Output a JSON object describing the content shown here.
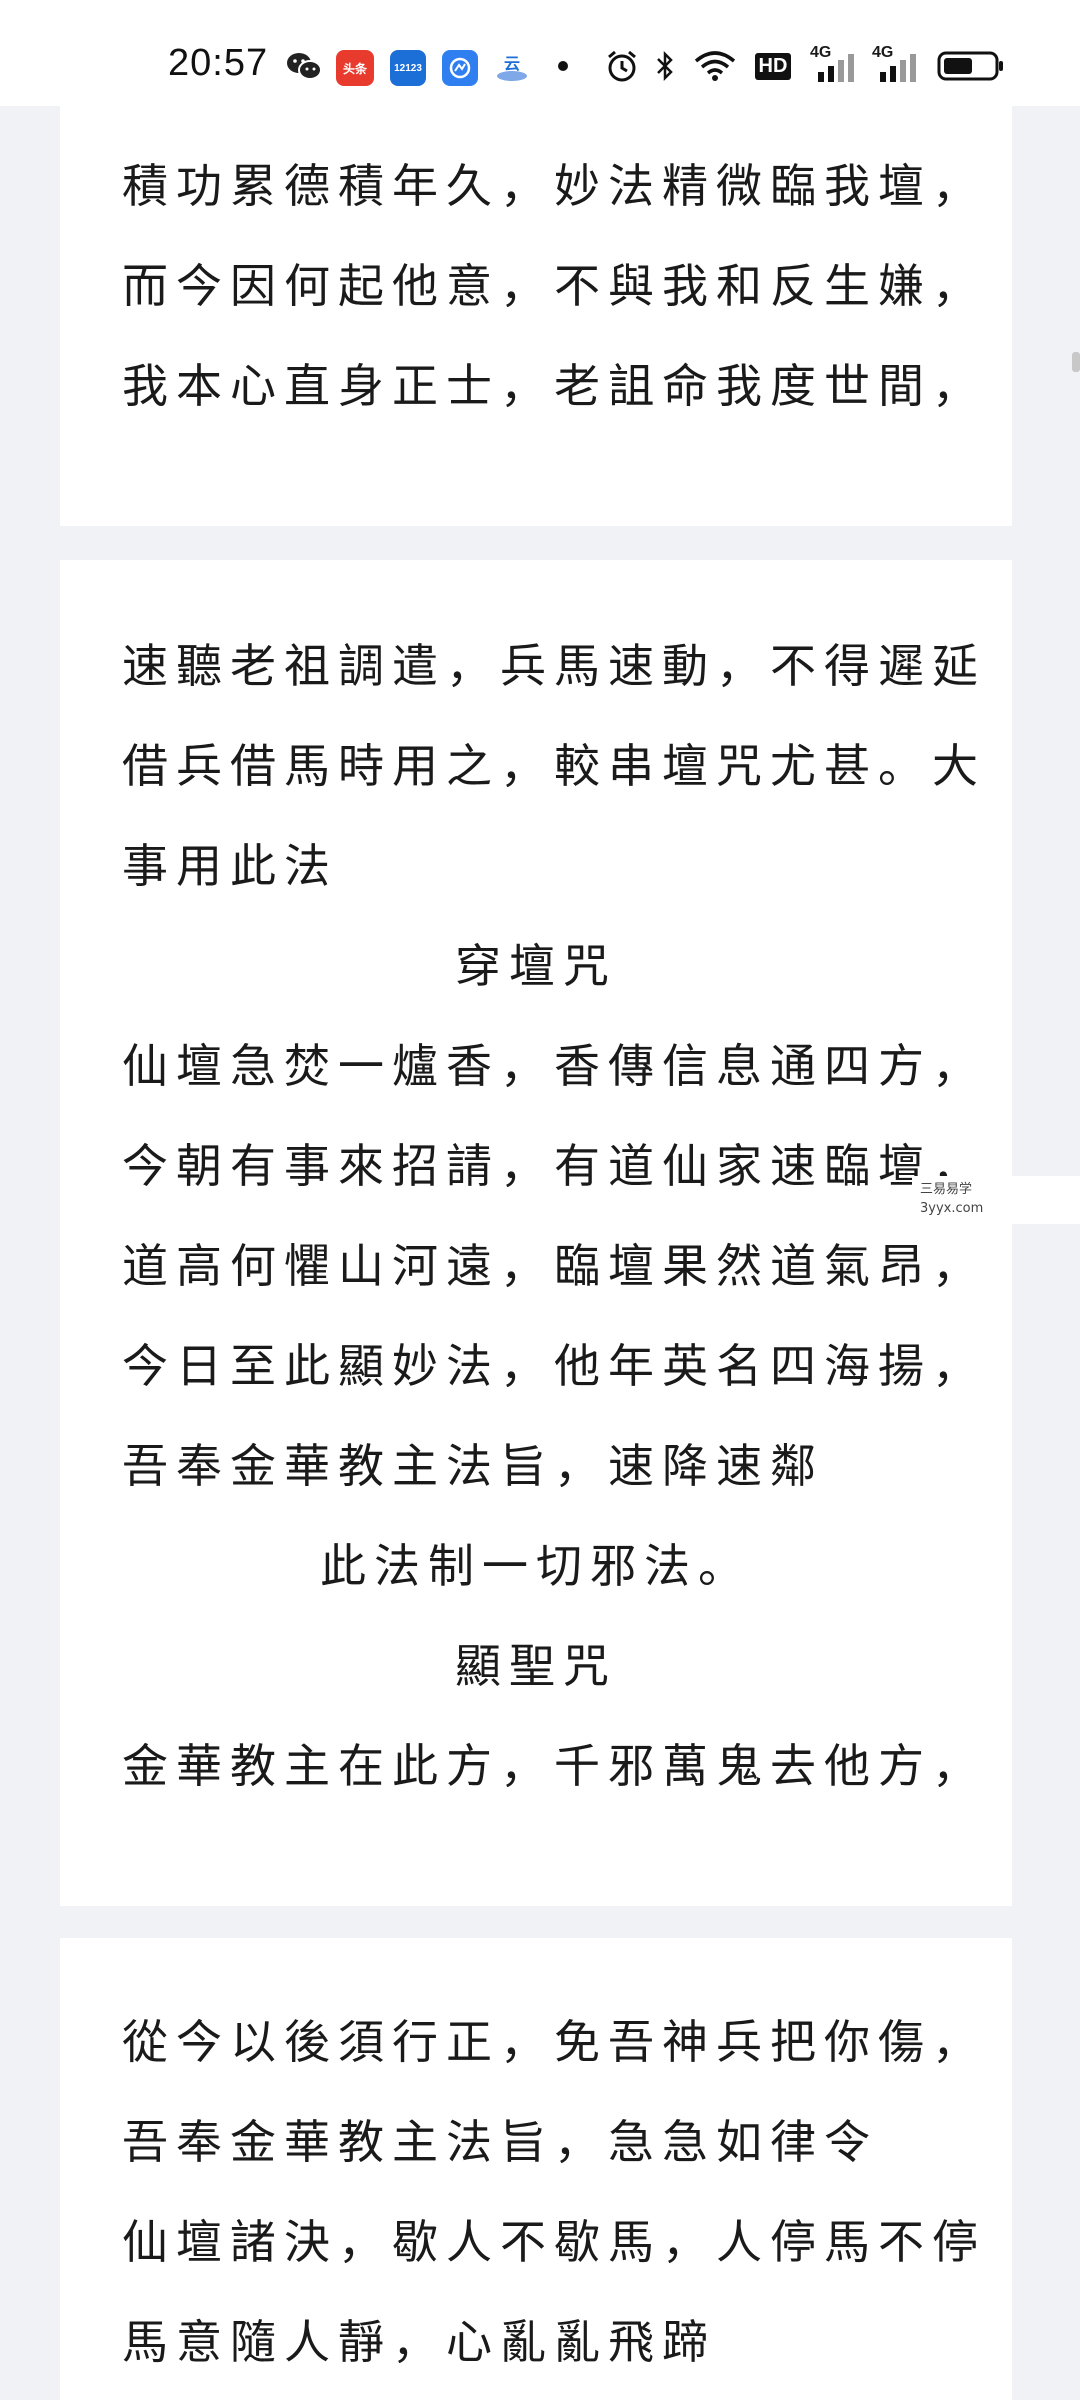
{
  "status_bar": {
    "time": "20:57",
    "icons": [
      "wechat-icon",
      "toutiao-icon",
      "traffic-12123-icon",
      "app-icon",
      "cloud-app-icon",
      "dot-icon",
      "alarm-icon",
      "bluetooth-icon",
      "wifi-icon",
      "hd-icon",
      "signal-4g-icon",
      "signal-4g-icon",
      "battery-icon"
    ],
    "badge_toutiao": "头条",
    "badge_12123": "12123",
    "hd_label": "HD",
    "net_label_1": "4G",
    "net_label_2": "4G"
  },
  "cards": {
    "card1": {
      "lines": [
        "積功累德積年久，妙法精微臨我壇，",
        "而今因何起他意，不與我和反生嫌，",
        "我本心直身正士，老詛命我度世間，"
      ]
    },
    "card2": {
      "lines": [
        "速聽老祖調遣，兵馬速動，不得遲延",
        "借兵借馬時用之，較串壇咒尤甚。大",
        "事用此法",
        "穿壇咒",
        "仙壇急焚一爐香，香傳信息通四方，",
        "今朝有事來招請，有道仙家速臨壇，",
        "道高何懼山河遠，臨壇果然道氣昂，",
        "今日至此顯妙法，他年英名四海揚，",
        "吾奉金華教主法旨，速降速鄰",
        "此法制一切邪法。",
        "顯聖咒",
        "金華教主在此方，千邪萬鬼去他方，"
      ]
    },
    "card3": {
      "lines": [
        "從今以後須行正，免吾神兵把你傷，",
        "吾奉金華教主法旨，急急如律令",
        "仙壇諸決，歇人不歇馬，人停馬不停",
        "馬意隨人靜，心亂亂飛蹄"
      ]
    }
  },
  "watermark": {
    "line1": "三易易学",
    "line2": "3yyx.com"
  }
}
